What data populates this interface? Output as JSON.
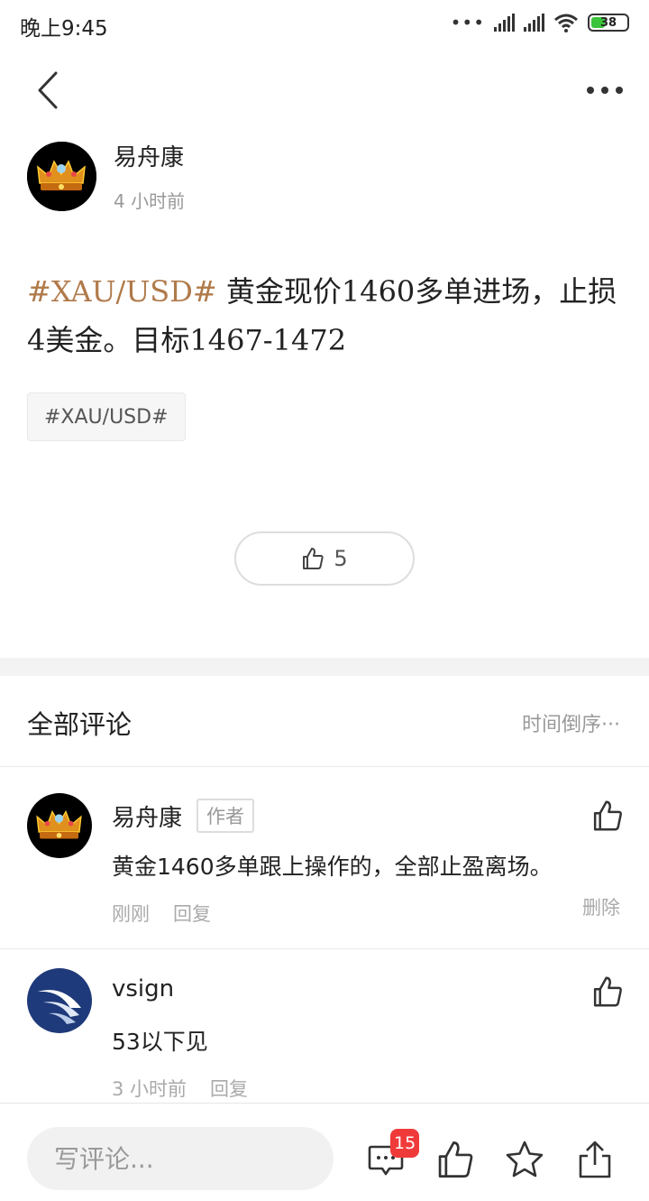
{
  "status_bar": {
    "time": "晚上9:45",
    "battery": "38"
  },
  "post": {
    "author_name": "易舟康",
    "time": "4 小时前",
    "hashtag": "#XAU/USD#",
    "text": " 黄金现价1460多单进场，止损4美金。目标1467-1472",
    "tag_chip": "#XAU/USD#",
    "like_count": "5"
  },
  "comments_section": {
    "title": "全部评论",
    "sort_label": "时间倒序",
    "comments": [
      {
        "name": "易舟康",
        "badge": "作者",
        "text": "黄金1460多单跟上操作的，全部止盈离场。",
        "time": "刚刚",
        "reply_label": "回复",
        "delete_label": "删除"
      },
      {
        "name": "vsign",
        "text": "53以下见",
        "time": "3 小时前",
        "reply_label": "回复"
      }
    ]
  },
  "bottom_bar": {
    "input_placeholder": "写评论...",
    "comment_badge_count": "15"
  },
  "colors": {
    "accent": "#b07a4a",
    "badge": "#f03a3a",
    "battery": "#3bc43b"
  }
}
